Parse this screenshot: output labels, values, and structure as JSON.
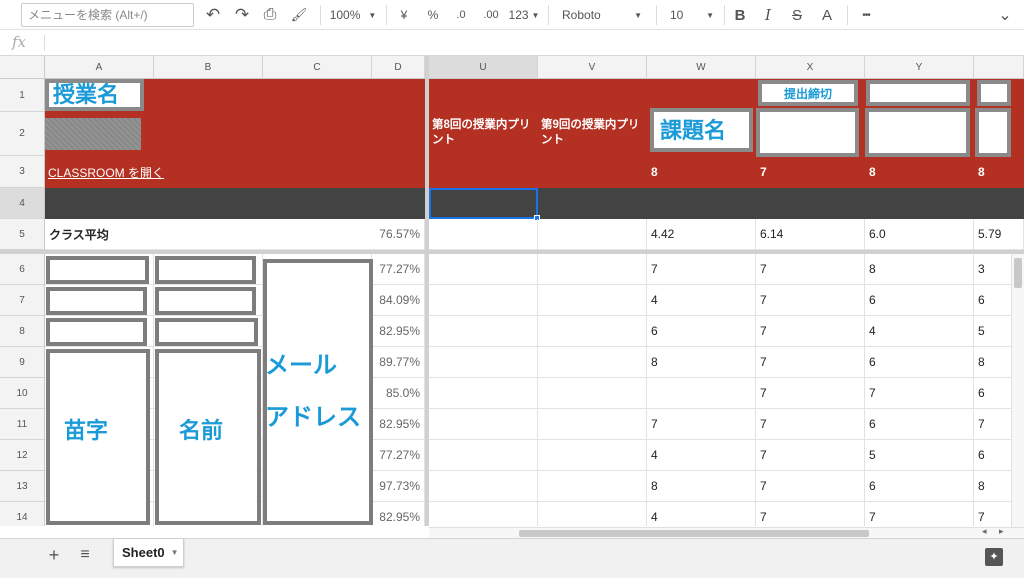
{
  "toolbar": {
    "menu_search_placeholder": "メニューを検索 (Alt+/)",
    "undo_icon": "↶",
    "redo_icon": "↷",
    "print_icon": "⎙",
    "paint_icon": "🖌",
    "zoom": "100%",
    "currency": "¥",
    "percent": "%",
    "decrease_decimal": ".0",
    "increase_decimal": ".00",
    "number_format": "123",
    "font": "Roboto",
    "font_size": "10",
    "bold": "B",
    "italic": "I",
    "strike": "S",
    "text_color": "A",
    "more": "•••",
    "collapse": "⌄"
  },
  "formula_bar": {
    "fx": "fx",
    "value": ""
  },
  "columns": [
    "A",
    "B",
    "C",
    "D",
    "U",
    "V",
    "W",
    "X",
    "Y"
  ],
  "rows": [
    "1",
    "2",
    "3",
    "4",
    "5",
    "6",
    "7",
    "8",
    "9",
    "10",
    "11",
    "12",
    "13",
    "14"
  ],
  "header": {
    "course_name": "授業名",
    "classroom_link": "CLASSROOM を開く",
    "u2": "第8回の授業内プリント",
    "v2": "第9回の授業内プリント",
    "assignment_name": "課題名",
    "deadline": "提出締切",
    "w3": "8",
    "x3": "7",
    "y3": "8",
    "z3": "8"
  },
  "average": {
    "label": "クラス平均",
    "d": "76.57%",
    "w": "4.42",
    "x": "6.14",
    "y": "6.0",
    "z": "5.79"
  },
  "students": [
    {
      "d": "77.27%",
      "w": "7",
      "x": "7",
      "y": "8",
      "z": "3"
    },
    {
      "d": "84.09%",
      "w": "4",
      "x": "7",
      "y": "6",
      "z": "6"
    },
    {
      "d": "82.95%",
      "w": "6",
      "x": "7",
      "y": "4",
      "z": "5"
    },
    {
      "d": "89.77%",
      "w": "8",
      "x": "7",
      "y": "6",
      "z": "8"
    },
    {
      "d": "85.0%",
      "w": "",
      "x": "7",
      "y": "7",
      "z": "6"
    },
    {
      "d": "82.95%",
      "w": "7",
      "x": "7",
      "y": "6",
      "z": "7"
    },
    {
      "d": "77.27%",
      "w": "4",
      "x": "7",
      "y": "5",
      "z": "6"
    },
    {
      "d": "97.73%",
      "w": "8",
      "x": "7",
      "y": "6",
      "z": "8"
    },
    {
      "d": "82.95%",
      "w": "4",
      "x": "7",
      "y": "7",
      "z": "7"
    }
  ],
  "annotations": {
    "last_name": "苗字",
    "first_name": "名前",
    "email_1": "メール",
    "email_2": "アドレス"
  },
  "bottom": {
    "add_sheet": "+",
    "sheet_list": "≡",
    "sheet_name": "Sheet0",
    "explore": "✦"
  },
  "colors": {
    "header_red": "#b33022",
    "dark_row": "#434343",
    "accent_blue": "#1a9bd7"
  }
}
